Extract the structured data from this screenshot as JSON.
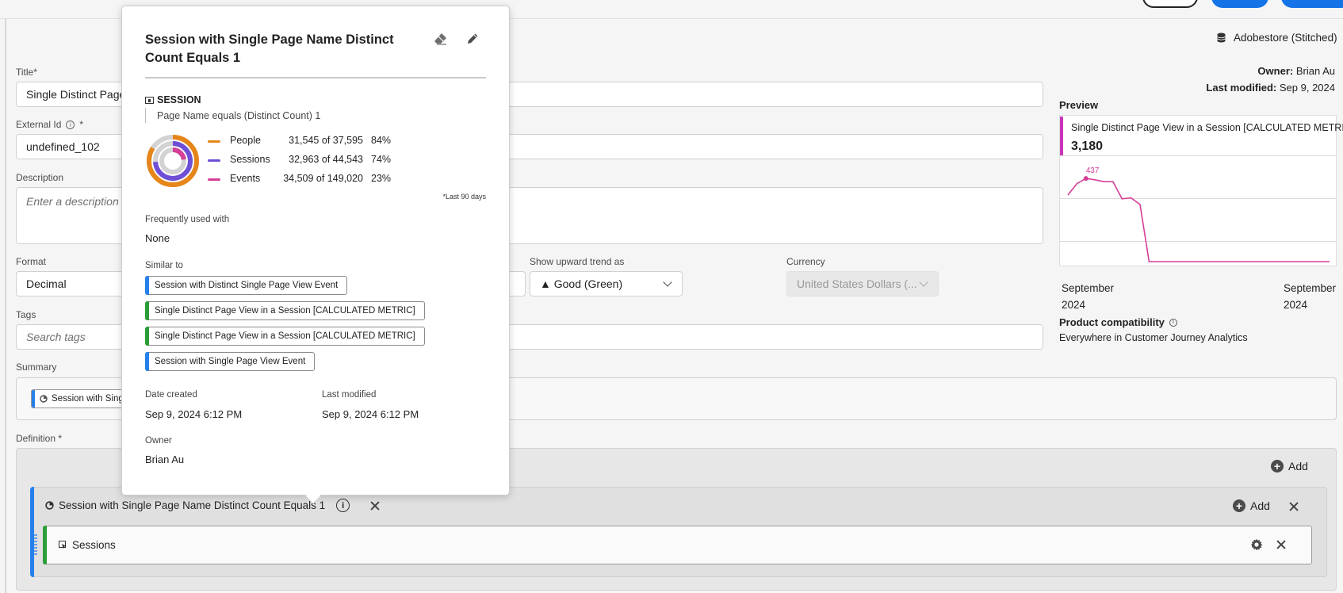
{
  "header": {
    "data_source": "Adobestore (Stitched)",
    "owner_label": "Owner:",
    "owner_value": "Brian Au",
    "modified_label": "Last modified:",
    "modified_value": "Sep 9, 2024"
  },
  "form": {
    "title_label": "Title*",
    "title_value": "Single Distinct Page View in a Session [CALCULATED METRIC]",
    "title_visible": "Single Distinct Page V",
    "external_id_label": "External Id",
    "external_id_required": "*",
    "external_id_value": "undefined_102",
    "description_label": "Description",
    "description_placeholder": "Enter a description for",
    "format_label": "Format",
    "format_value": "Decimal",
    "trend_label": "Show upward trend as",
    "trend_value": "▲ Good (Green)",
    "currency_label": "Currency",
    "currency_value": "United States Dollars (...",
    "tags_label": "Tags",
    "tags_placeholder": "Search tags",
    "summary_label": "Summary",
    "summary_chip": "Session with Singl",
    "definition_label": "Definition *"
  },
  "preview": {
    "label": "Preview",
    "metric_name": "Single Distinct Page View in a Session [CALCULATED METRIC]",
    "total": "3,180",
    "peak_label": "437",
    "x_start_1": "September",
    "x_start_2": "2024",
    "x_end_1": "September",
    "x_end_2": "2024",
    "series_color": "#d53f97",
    "chart_data": {
      "type": "line",
      "x": [
        1,
        2,
        3,
        4,
        5,
        6,
        7,
        8,
        9,
        10,
        11,
        12,
        13,
        14,
        15,
        16,
        17,
        18,
        19,
        20,
        21,
        22,
        23,
        24,
        25,
        26,
        27,
        28,
        29,
        30
      ],
      "values": [
        350,
        410,
        437,
        430,
        420,
        420,
        330,
        335,
        300,
        0,
        0,
        0,
        0,
        0,
        0,
        0,
        0,
        0,
        0,
        0,
        0,
        0,
        0,
        0,
        0,
        0,
        0,
        0,
        0,
        0
      ],
      "ylim": [
        0,
        500
      ],
      "grid": true,
      "annotations": [
        "437"
      ]
    }
  },
  "compat": {
    "label": "Product compatibility",
    "value": "Everywhere in Customer Journey Analytics"
  },
  "definition": {
    "add_label": "Add",
    "segment_title": "Session with Single Page Name Distinct Count Equals 1",
    "segment_add_label": "Add",
    "metric_label": "Sessions"
  },
  "popover": {
    "title": "Session with Single Page Name Distinct Count Equals 1",
    "container": "SESSION",
    "rule": "Page Name equals (Distinct Count) 1",
    "stats": [
      {
        "name": "People",
        "value": "31,545 of 37,595",
        "pct": "84%",
        "ratio": 0.84,
        "color": "#e68619"
      },
      {
        "name": "Sessions",
        "value": "32,963 of 44,543",
        "pct": "74%",
        "ratio": 0.74,
        "color": "#6e4fd6"
      },
      {
        "name": "Events",
        "value": "34,509 of 149,020",
        "pct": "23%",
        "ratio": 0.23,
        "color": "#d53f97"
      }
    ],
    "footnote": "*Last 90 days",
    "freq_label": "Frequently used with",
    "freq_value": "None",
    "similar_label": "Similar to",
    "similar": [
      {
        "label": "Session with Distinct Single Page View Event",
        "color": "#2680eb"
      },
      {
        "label": "Single Distinct Page View in a Session [CALCULATED METRIC]",
        "color": "#2d9d3a"
      },
      {
        "label": "Single Distinct Page View in a Session [CALCULATED METRIC]",
        "color": "#2d9d3a"
      },
      {
        "label": "Session with Single Page View Event",
        "color": "#2680eb"
      }
    ],
    "created_label": "Date created",
    "created_value": "Sep 9, 2024 6:12 PM",
    "modified_label": "Last modified",
    "modified_value": "Sep 9, 2024 6:12 PM",
    "owner_label": "Owner",
    "owner_value": "Brian Au"
  },
  "colors": {
    "segment_accent": "#2680eb",
    "metric_accent": "#2d9d3a",
    "preview_accent": "#c936b9"
  }
}
